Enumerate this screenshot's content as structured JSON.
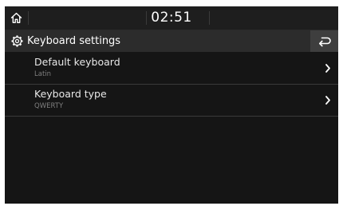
{
  "status_bar": {
    "time": "02:51",
    "home_icon": "home-icon"
  },
  "header": {
    "title": "Keyboard settings",
    "title_icon": "gear-icon",
    "back_icon": "back-arrow-icon"
  },
  "settings": {
    "items": [
      {
        "label": "Default keyboard",
        "value": "Latin",
        "icon": "chevron-right-icon"
      },
      {
        "label": "Keyboard type",
        "value": "QWERTY",
        "icon": "chevron-right-icon"
      }
    ]
  },
  "colors": {
    "background": "#151515",
    "title_bar": "#2c2c2c",
    "back_button": "#3e3e3e",
    "text_primary": "#ffffff",
    "text_secondary": "#7f7f7f"
  }
}
